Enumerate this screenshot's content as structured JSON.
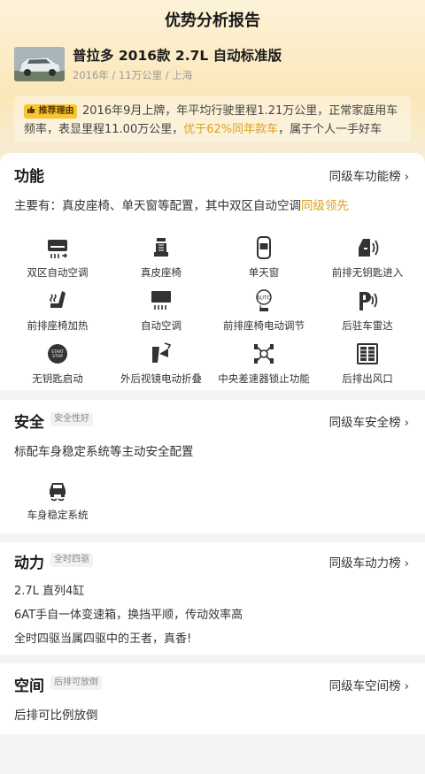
{
  "page_title": "优势分析报告",
  "car": {
    "title": "普拉多 2016款 2.7L 自动标准版",
    "meta": "2016年 / 11万公里 / 上海"
  },
  "reason": {
    "tag": "推荐理由",
    "text_before": "2016年9月上牌，年平均行驶里程1.21万公里，正常家庭用车频率，表显里程11.00万公里，",
    "highlight": "优于62%同年款车",
    "text_after": "，属于个人一手好车"
  },
  "function_section": {
    "title": "功能",
    "link": "同级车功能榜",
    "desc_before": "主要有：真皮座椅、单天窗等配置，其中双区自动空调",
    "desc_highlight": "同级领先",
    "features": [
      {
        "label": "双区自动空调",
        "icon": "dual-zone-ac-icon"
      },
      {
        "label": "真皮座椅",
        "icon": "leather-seat-icon"
      },
      {
        "label": "单天窗",
        "icon": "sunroof-icon"
      },
      {
        "label": "前排无钥匙进入",
        "icon": "keyless-entry-icon"
      },
      {
        "label": "前排座椅加热",
        "icon": "seat-heating-icon"
      },
      {
        "label": "自动空调",
        "icon": "auto-ac-icon"
      },
      {
        "label": "前排座椅电动调节",
        "icon": "power-seat-icon"
      },
      {
        "label": "后驻车雷达",
        "icon": "parking-radar-icon"
      },
      {
        "label": "无钥匙启动",
        "icon": "start-stop-button-icon"
      },
      {
        "label": "外后视镜电动折叠",
        "icon": "mirror-fold-icon"
      },
      {
        "label": "中央差速器锁止功能",
        "icon": "diff-lock-icon"
      },
      {
        "label": "后排出风口",
        "icon": "rear-vent-icon"
      }
    ]
  },
  "safety_section": {
    "title": "安全",
    "badge": "安全性好",
    "link": "同级车安全榜",
    "desc": "标配车身稳定系统等主动安全配置",
    "features": [
      {
        "label": "车身稳定系统",
        "icon": "stability-control-icon"
      }
    ]
  },
  "power_section": {
    "title": "动力",
    "badge": "全时四驱",
    "link": "同级车动力榜",
    "lines": [
      "2.7L 直列4缸",
      "6AT手自一体变速箱，换挡平顺，传动效率高",
      "全时四驱当属四驱中的王者，真香!"
    ]
  },
  "space_section": {
    "title": "空间",
    "badge": "后排可放倒",
    "link": "同级车空间榜",
    "desc": "后排可比例放倒"
  },
  "chevron": "›",
  "colors": {
    "accent": "#d9a21b",
    "tag_bg": "#f7c531",
    "header_gradient_top": "#fdf3d9"
  }
}
